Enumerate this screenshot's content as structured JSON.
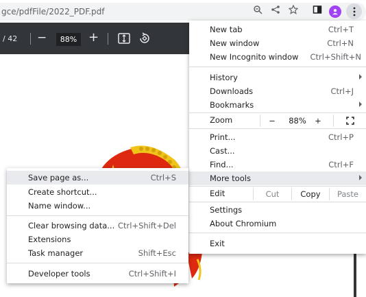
{
  "address_bar": {
    "url": "gce/pdfFile/2022_PDF.pdf",
    "icons": [
      "zoom-icon",
      "share-icon",
      "bookmark-star-icon",
      "side-panel-icon",
      "profile-icon",
      "kebab-menu-icon"
    ]
  },
  "pdf_toolbar": {
    "page_count": "/ 42",
    "zoom_value": "88%",
    "zoom_out": "−",
    "zoom_in": "+"
  },
  "main_menu": {
    "new_tab": {
      "label": "New tab",
      "shortcut": "Ctrl+T"
    },
    "new_window": {
      "label": "New window",
      "shortcut": "Ctrl+N"
    },
    "new_incognito": {
      "label": "New Incognito window",
      "shortcut": "Ctrl+Shift+N"
    },
    "history": {
      "label": "History"
    },
    "downloads": {
      "label": "Downloads",
      "shortcut": "Ctrl+J"
    },
    "bookmarks": {
      "label": "Bookmarks"
    },
    "zoom": {
      "label": "Zoom",
      "minus": "−",
      "value": "88%",
      "plus": "+"
    },
    "print": {
      "label": "Print...",
      "shortcut": "Ctrl+P"
    },
    "cast": {
      "label": "Cast..."
    },
    "find": {
      "label": "Find...",
      "shortcut": "Ctrl+F"
    },
    "more_tools": {
      "label": "More tools"
    },
    "edit": {
      "label": "Edit",
      "cut": "Cut",
      "copy": "Copy",
      "paste": "Paste"
    },
    "settings": {
      "label": "Settings"
    },
    "about": {
      "label": "About Chromium"
    },
    "exit": {
      "label": "Exit"
    }
  },
  "more_tools_submenu": {
    "save_page": {
      "label": "Save page as...",
      "shortcut": "Ctrl+S"
    },
    "create_shortcut": {
      "label": "Create shortcut..."
    },
    "name_window": {
      "label": "Name window..."
    },
    "clear_browsing": {
      "label": "Clear browsing data...",
      "shortcut": "Ctrl+Shift+Del"
    },
    "extensions": {
      "label": "Extensions"
    },
    "task_manager": {
      "label": "Task manager",
      "shortcut": "Shift+Esc"
    },
    "developer_tools": {
      "label": "Developer tools",
      "shortcut": "Ctrl+Shift+I"
    }
  },
  "colors": {
    "accent": "#a142f4",
    "pdf_toolbar_bg": "#323639",
    "highlight": "#e8eaed",
    "emblem_red": "#de2910",
    "emblem_gold": "#f0c419"
  }
}
